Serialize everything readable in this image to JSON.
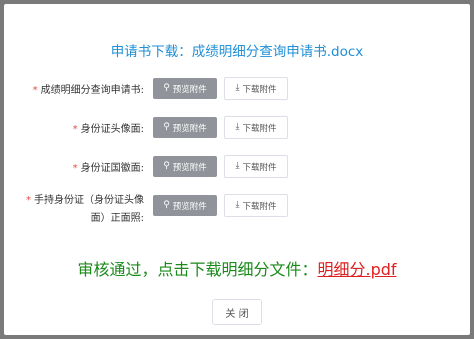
{
  "dialog": {
    "title": "申请书下载：成绩明细分查询申请书.docx",
    "rows": [
      {
        "star": "*",
        "label": "成绩明细分查询申请书:",
        "preview": "预览附件",
        "download": "下载附件"
      },
      {
        "star": "*",
        "label": "身份证头像面:",
        "preview": "预览附件",
        "download": "下载附件"
      },
      {
        "star": "*",
        "label": "身份证国徽面:",
        "preview": "预览附件",
        "download": "下载附件"
      },
      {
        "star": "*",
        "label": "手持身份证（身份证头像面）正面照:",
        "preview": "预览附件",
        "download": "下载附件"
      }
    ],
    "notice_text": "审核通过，点击下载明细分文件：",
    "notice_link": "明细分.pdf",
    "close_label": "关 闭"
  },
  "icons": {
    "preview": "search-icon",
    "download": "download-icon"
  },
  "colors": {
    "title": "#1f8fd6",
    "notice": "#1a8a1a",
    "link": "#e02020",
    "required": "#e84c3d",
    "preview_button": "#909399"
  }
}
